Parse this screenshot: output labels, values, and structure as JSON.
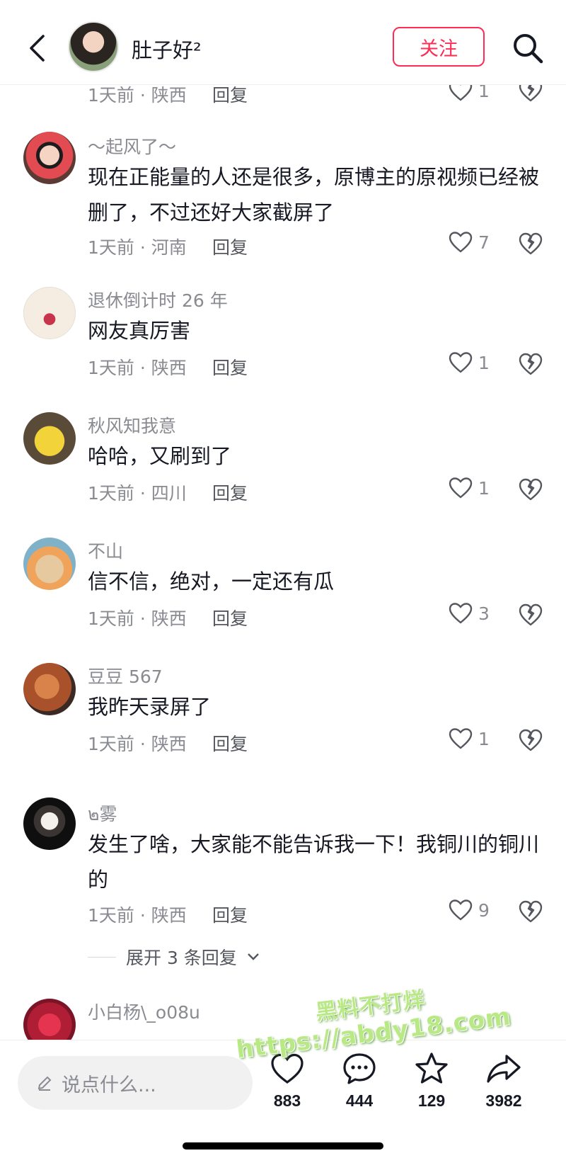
{
  "header": {
    "author": "肚子好²",
    "follow_label": "关注"
  },
  "partial_top": {
    "time": "1天前",
    "location": "陕西",
    "reply_label": "回复",
    "likes": "1"
  },
  "comments": [
    {
      "user": "～起风了～",
      "text": "现在正能量的人还是很多，原博主的原视频已经被删了，不过还好大家截屏了",
      "time": "1天前",
      "location": "河南",
      "reply_label": "回复",
      "likes": "7"
    },
    {
      "user": "退休倒计时 26 年",
      "text": "网友真厉害",
      "time": "1天前",
      "location": "陕西",
      "reply_label": "回复",
      "likes": "1"
    },
    {
      "user": "秋风知我意",
      "text": "哈哈，又刷到了",
      "time": "1天前",
      "location": "四川",
      "reply_label": "回复",
      "likes": "1"
    },
    {
      "user": "不山",
      "text": "信不信，绝对，一定还有瓜",
      "time": "1天前",
      "location": "陕西",
      "reply_label": "回复",
      "likes": "3"
    },
    {
      "user": "豆豆 567",
      "text": "我昨天录屏了",
      "time": "1天前",
      "location": "陕西",
      "reply_label": "回复",
      "likes": "1"
    },
    {
      "user": "๒雾",
      "text": "发生了啥，大家能不能告诉我一下！我铜川的铜川的",
      "time": "1天前",
      "location": "陕西",
      "reply_label": "回复",
      "likes": "9"
    },
    {
      "user": "小白杨\\_o08u",
      "text": "",
      "time": "",
      "location": "",
      "reply_label": "",
      "likes": ""
    }
  ],
  "expand_label": "展开 3 条回复",
  "watermark": {
    "line1": "黑料不打烊",
    "line2": "https://abdy18.com"
  },
  "bottom_bar": {
    "input_placeholder": "说点什么...",
    "likes": "883",
    "comments": "444",
    "favorites": "129",
    "shares": "3982"
  },
  "colors": {
    "accent": "#fe2c55",
    "text": "#161823",
    "muted": "#8a8b91"
  }
}
